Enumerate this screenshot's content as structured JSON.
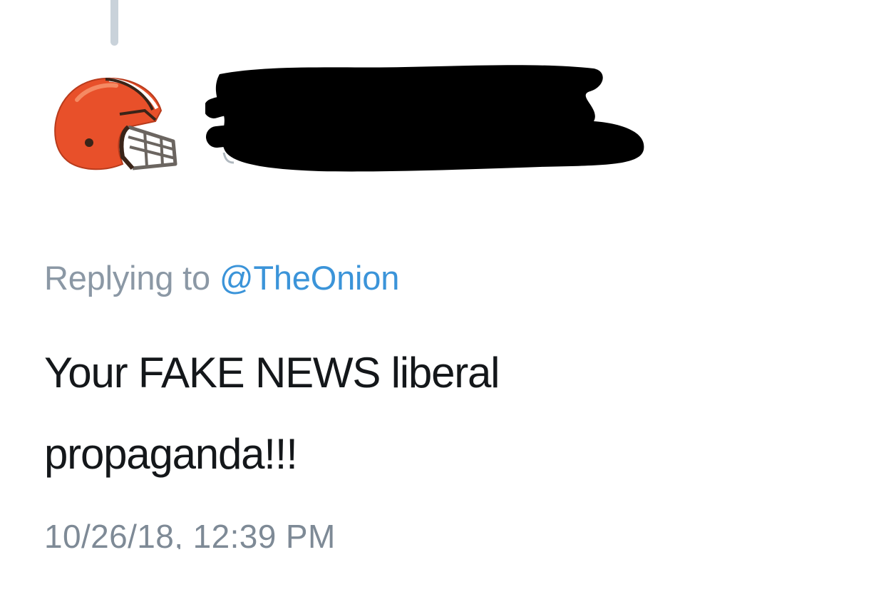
{
  "tweet": {
    "reply_prefix": "Replying to",
    "reply_handle": "@TheOnion",
    "text_line1": "Your FAKE NEWS liberal",
    "text_line2": "propaganda!!!",
    "timestamp": "10/26/18, 12:39 PM"
  },
  "author": {
    "avatar_icon": "football-helmet-icon",
    "name_redacted": true
  },
  "colors": {
    "helmet_orange": "#e8502a",
    "helmet_dark": "#3a2418",
    "reply_gray": "#8b98a5",
    "link_blue": "#3b94d9",
    "text_black": "#14171a",
    "thread_line": "#c9d2da"
  }
}
